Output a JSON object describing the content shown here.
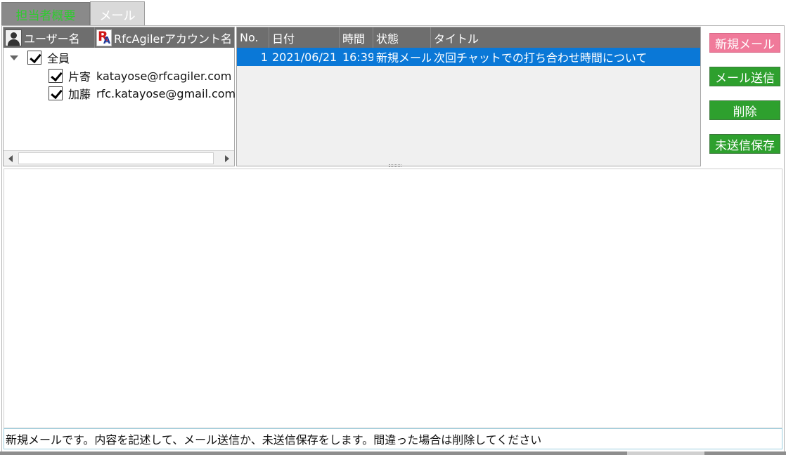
{
  "tabs": [
    {
      "label": "担当者概要",
      "active": false
    },
    {
      "label": "メール",
      "active": true
    }
  ],
  "tree": {
    "header": {
      "user_col": "ユーザー名",
      "account_col": "RfcAgilerアカウント名",
      "user_icon": "user-icon",
      "logo_icon": "rfcagiler-logo-icon",
      "logo_letters": {
        "r": "R",
        "a": "A"
      }
    },
    "root": {
      "label": "全員",
      "checked": true
    },
    "children": [
      {
        "name": "片寄",
        "email": "katayose@rfcagiler.com",
        "checked": true
      },
      {
        "name": "加藤",
        "email": "rfc.katayose@gmail.com",
        "checked": true
      }
    ]
  },
  "mail_list": {
    "columns": [
      "No.",
      "日付",
      "時間",
      "状態",
      "タイトル"
    ],
    "rows": [
      {
        "no": "1",
        "date": "2021/06/21",
        "time": "16:39",
        "state": "新規メール",
        "title": "次回チャットでの打ち合わせ時間について",
        "selected": true
      }
    ],
    "selection_color": "#0a78d7"
  },
  "buttons": {
    "new_mail": "新規メール",
    "send_mail": "メール送信",
    "delete": "削除",
    "save_unsent": "未送信保存"
  },
  "colors": {
    "button_green": "#2ea02e",
    "button_pink": "#f07a9a",
    "header_gray": "#6e6e6e",
    "tab_text_green": "#2ecc2e"
  },
  "status_message": "新規メールです。内容を記述して、メール送信か、未送信保存をします。間違った場合は削除してください"
}
